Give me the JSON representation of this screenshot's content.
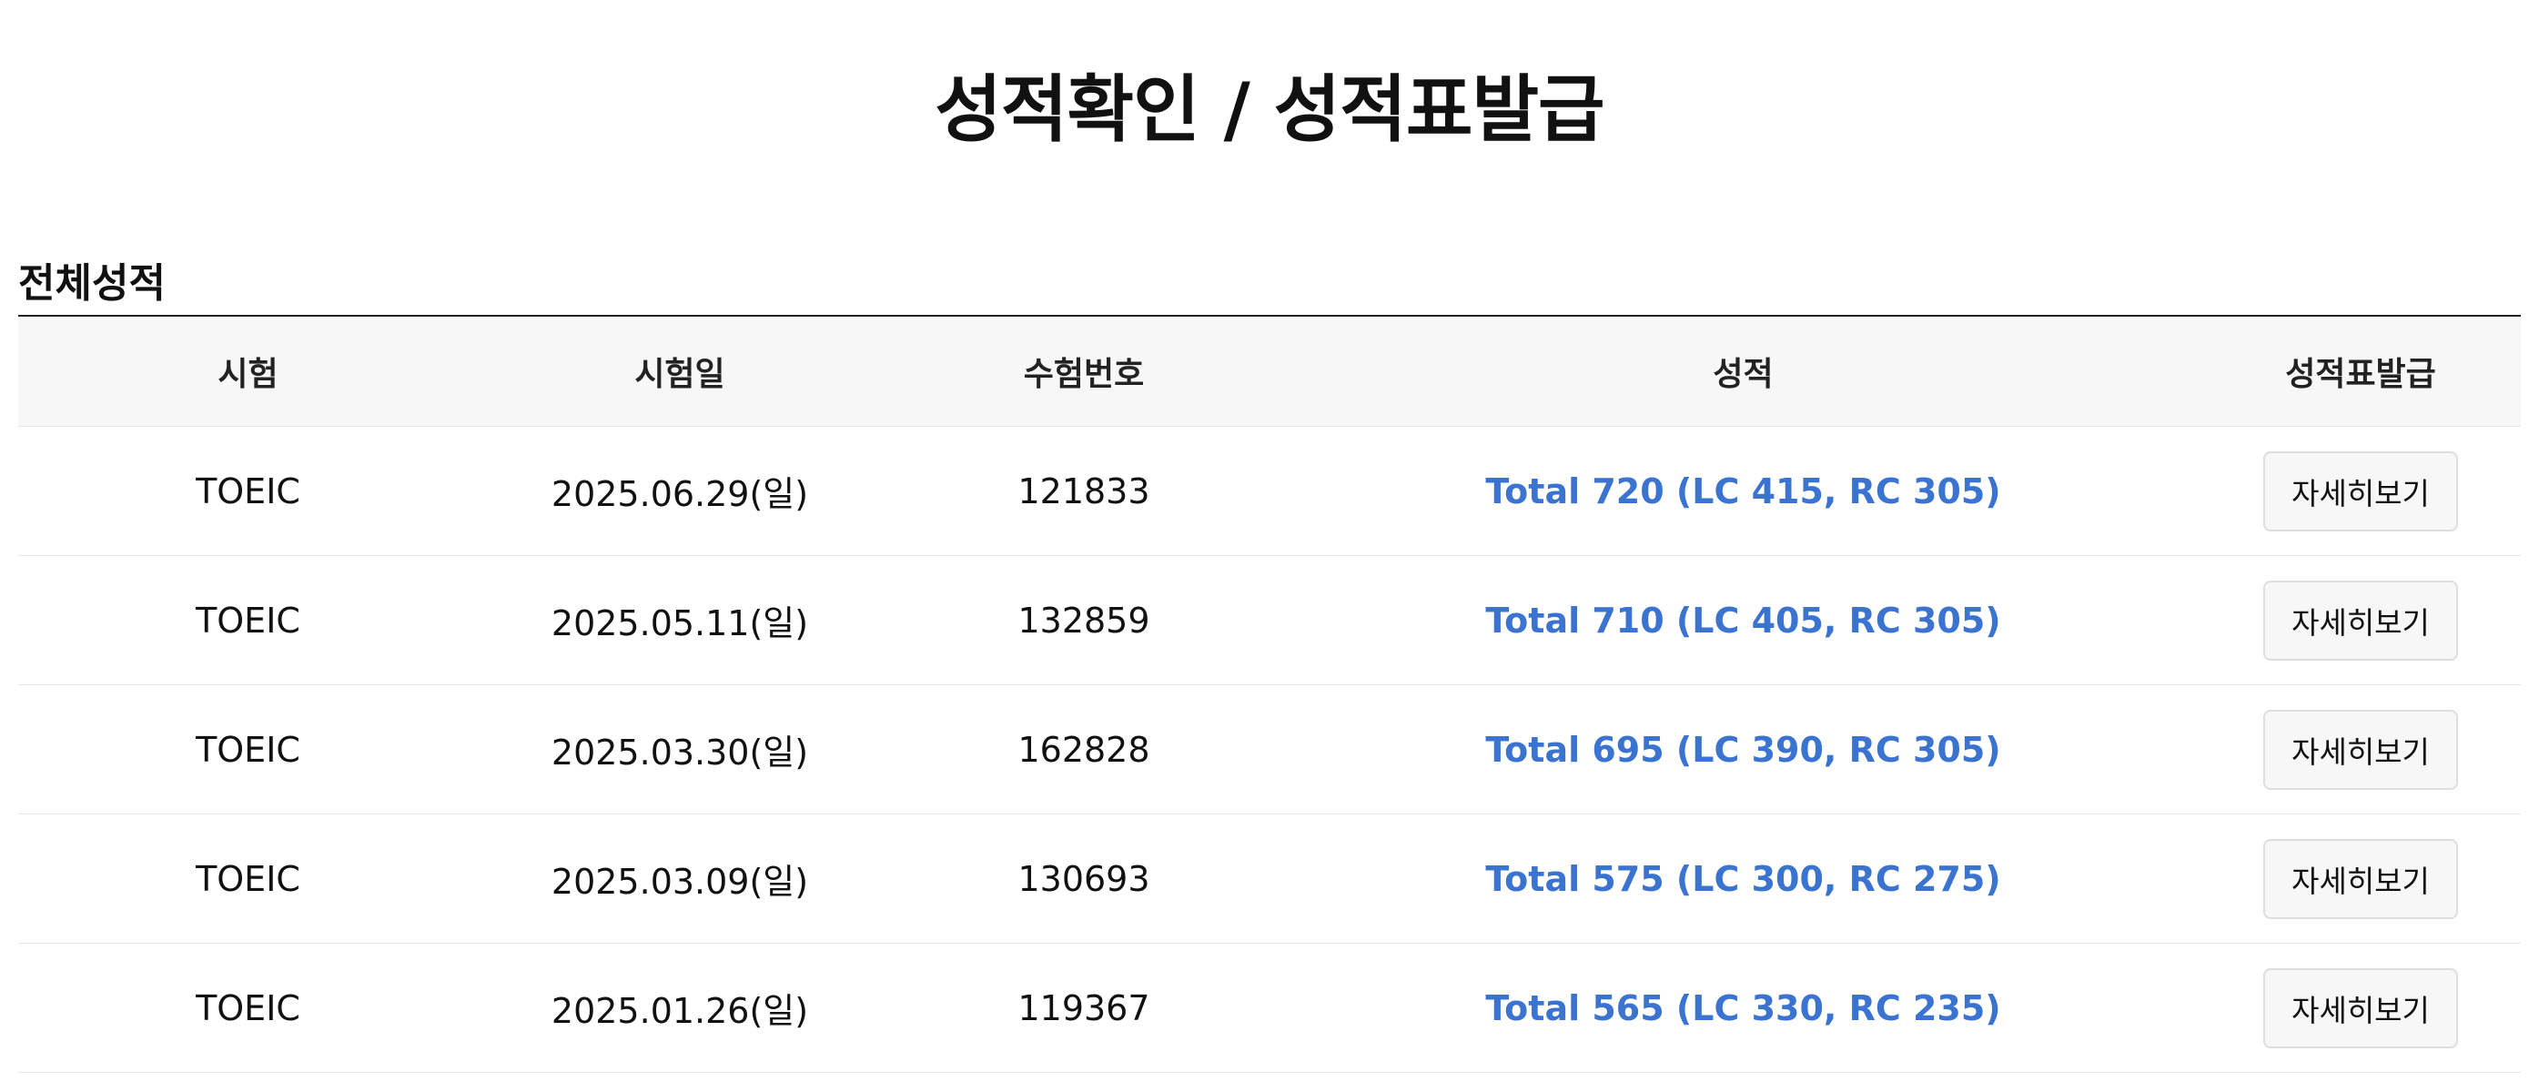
{
  "page": {
    "title": "성적확인 / 성적표발급",
    "section_title": "전체성적"
  },
  "table": {
    "headers": [
      "시험",
      "시험일",
      "수험번호",
      "성적",
      "성적표발급"
    ],
    "rows": [
      {
        "exam": "TOEIC",
        "date": "2025.06.29(일)",
        "number": "121833",
        "score": "Total 720 (LC 415, RC 305)",
        "action": "자세히보기"
      },
      {
        "exam": "TOEIC",
        "date": "2025.05.11(일)",
        "number": "132859",
        "score": "Total 710 (LC 405, RC 305)",
        "action": "자세히보기"
      },
      {
        "exam": "TOEIC",
        "date": "2025.03.30(일)",
        "number": "162828",
        "score": "Total 695 (LC 390, RC 305)",
        "action": "자세히보기"
      },
      {
        "exam": "TOEIC",
        "date": "2025.03.09(일)",
        "number": "130693",
        "score": "Total 575 (LC 300, RC 275)",
        "action": "자세히보기"
      },
      {
        "exam": "TOEIC",
        "date": "2025.01.26(일)",
        "number": "119367",
        "score": "Total 565 (LC 330, RC 235)",
        "action": "자세히보기"
      }
    ]
  },
  "colors": {
    "score_link": "#3b73d1",
    "header_background": "#f7f7f7",
    "table_top_border": "#222222"
  }
}
